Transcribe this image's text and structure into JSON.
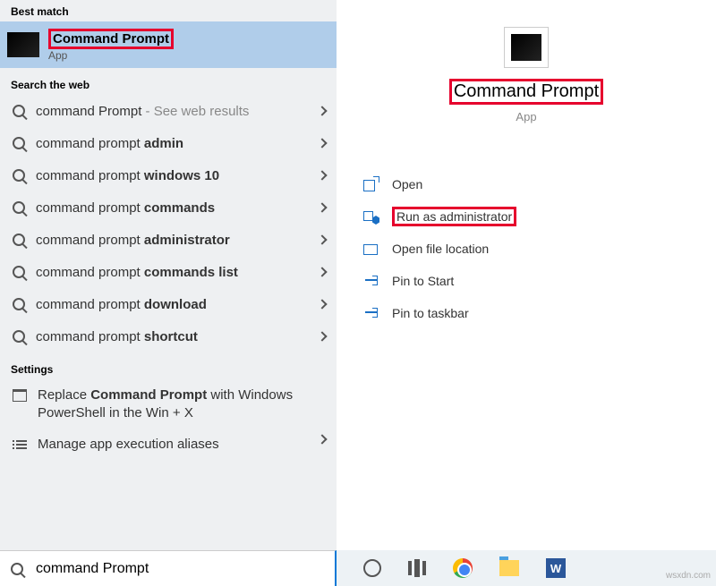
{
  "sections": {
    "best_match": "Best match",
    "search_web": "Search the web",
    "settings": "Settings"
  },
  "best_match_item": {
    "title": "Command Prompt",
    "subtitle": "App"
  },
  "web_results": [
    {
      "prefix": "command Prompt",
      "bold": "",
      "suffix": " - See web results"
    },
    {
      "prefix": "command prompt ",
      "bold": "admin",
      "suffix": ""
    },
    {
      "prefix": "command prompt ",
      "bold": "windows 10",
      "suffix": ""
    },
    {
      "prefix": "command prompt ",
      "bold": "commands",
      "suffix": ""
    },
    {
      "prefix": "command prompt ",
      "bold": "administrator",
      "suffix": ""
    },
    {
      "prefix": "command prompt ",
      "bold": "commands list",
      "suffix": ""
    },
    {
      "prefix": "command prompt ",
      "bold": "download",
      "suffix": ""
    },
    {
      "prefix": "command prompt ",
      "bold": "shortcut",
      "suffix": ""
    }
  ],
  "settings_items": [
    {
      "text_pre": "Replace ",
      "text_bold": "Command Prompt",
      "text_post": " with Windows PowerShell in the Win + X"
    },
    {
      "text_pre": "Manage app execution aliases",
      "text_bold": "",
      "text_post": ""
    }
  ],
  "detail": {
    "title": "Command Prompt",
    "subtitle": "App"
  },
  "actions": [
    {
      "label": "Open",
      "icon": "open"
    },
    {
      "label": "Run as administrator",
      "icon": "admin",
      "highlight": true
    },
    {
      "label": "Open file location",
      "icon": "folder"
    },
    {
      "label": "Pin to Start",
      "icon": "pin"
    },
    {
      "label": "Pin to taskbar",
      "icon": "pin"
    }
  ],
  "search": {
    "value": "command Prompt"
  },
  "word_letter": "W",
  "watermark": "wsxdn.com"
}
